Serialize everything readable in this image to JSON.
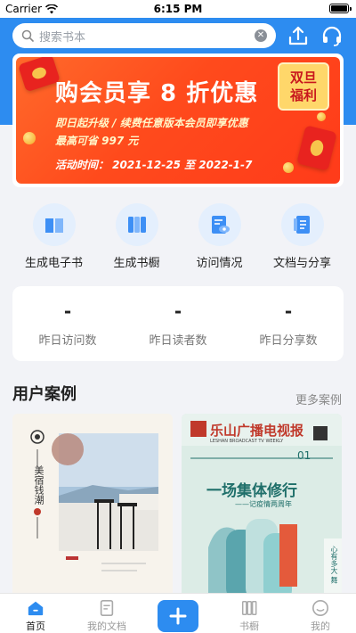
{
  "status_bar": {
    "carrier": "Carrier",
    "time": "6:15 PM"
  },
  "search": {
    "placeholder": "搜索书本"
  },
  "banner": {
    "title": "购会员享 8 折优惠",
    "badge_line1": "双旦",
    "badge_line2": "福利",
    "subtitle_line1": "即日起升级 / 续费任意版本会员即享优惠",
    "subtitle_line2": "最高可省 997 元",
    "date": "活动时间： 2021-12-25 至 2022-1-7"
  },
  "features": [
    {
      "label": "生成电子书",
      "icon": "ebook-icon"
    },
    {
      "label": "生成书橱",
      "icon": "bookshelf-icon"
    },
    {
      "label": "访问情况",
      "icon": "visit-stats-icon"
    },
    {
      "label": "文档与分享",
      "icon": "document-share-icon"
    }
  ],
  "stats": [
    {
      "value": "-",
      "label": "昨日访问数"
    },
    {
      "value": "-",
      "label": "昨日读者数"
    },
    {
      "value": "-",
      "label": "昨日分享数"
    }
  ],
  "cases": {
    "title": "用户案例",
    "more": "更多案例",
    "left_card": {
      "vertical_text": "美宿钱潮"
    },
    "right_card": {
      "masthead": "乐山广播电视报",
      "subtitle": "LESHAN BROADCAST TV WEEKLY",
      "issue": "01",
      "headline": "一场集体修行",
      "subheadline": "——记疫情两周年",
      "side_text": "心有多大 舞"
    }
  },
  "tabs": [
    {
      "label": "首页",
      "icon": "home-icon",
      "active": true
    },
    {
      "label": "我的文档",
      "icon": "document-icon",
      "active": false
    },
    {
      "label": "",
      "icon": "add-icon",
      "active": false
    },
    {
      "label": "书橱",
      "icon": "bookshelf-icon",
      "active": false
    },
    {
      "label": "我的",
      "icon": "profile-icon",
      "active": false
    }
  ],
  "colors": {
    "primary": "#2d8cf0",
    "banner_orange": "#ff4a1c",
    "background": "#f2f3f7"
  }
}
